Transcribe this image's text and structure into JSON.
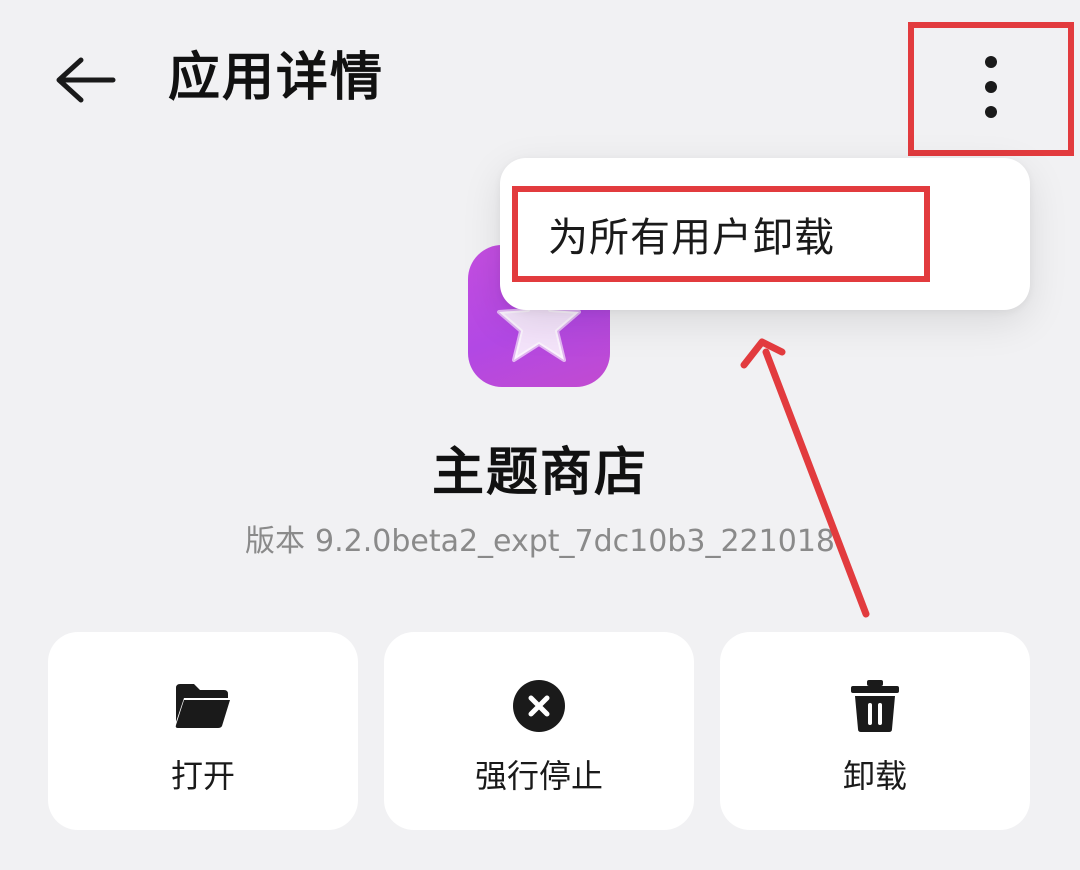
{
  "header": {
    "title": "应用详情",
    "back_icon": "back-arrow-icon",
    "more_icon": "more-vertical-icon"
  },
  "popup_menu": {
    "items": [
      {
        "label": "为所有用户卸载"
      }
    ]
  },
  "app": {
    "name": "主题商店",
    "version_label": "版本",
    "version_value": "9.2.0beta2_expt_7dc10b3_221018",
    "icon": "star-icon"
  },
  "actions": [
    {
      "label": "打开",
      "icon": "folder-icon"
    },
    {
      "label": "强行停止",
      "icon": "close-circle-icon"
    },
    {
      "label": "卸载",
      "icon": "trash-icon"
    }
  ],
  "colors": {
    "background": "#f1f1f3",
    "card": "#ffffff",
    "highlight": "#e23b3e",
    "app_icon": "#b248e4",
    "secondary_text": "#8a8a8a"
  }
}
